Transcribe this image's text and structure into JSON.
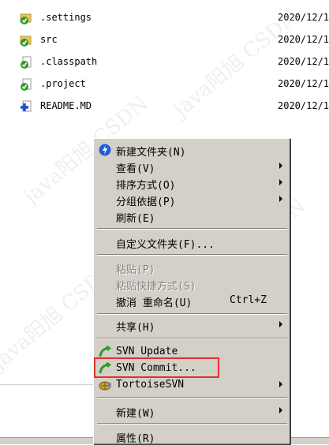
{
  "files": [
    {
      "name": ".settings",
      "date": "2020/12/1",
      "icon": "folder-svn-ok-icon"
    },
    {
      "name": "src",
      "date": "2020/12/1",
      "icon": "folder-svn-ok-icon"
    },
    {
      "name": ".classpath",
      "date": "2020/12/1",
      "icon": "file-svn-ok-icon"
    },
    {
      "name": ".project",
      "date": "2020/12/1",
      "icon": "file-svn-ok-icon"
    },
    {
      "name": "README.MD",
      "date": "2020/12/1",
      "icon": "file-svn-added-icon"
    }
  ],
  "menu": {
    "new_folder": "新建文件夹(N)",
    "view": "查看(V)",
    "sort_by": "排序方式(O)",
    "group_by": "分组依据(P)",
    "refresh": "刷新(E)",
    "customize_folder": "自定义文件夹(F)...",
    "paste": "粘贴(P)",
    "paste_shortcut": "粘贴快捷方式(S)",
    "undo_rename": "撤消 重命名(U)",
    "undo_shortcut": "Ctrl+Z",
    "share": "共享(H)",
    "svn_update": "SVN Update",
    "svn_commit": "SVN Commit...",
    "tortoise_svn": "TortoiseSVN",
    "new": "新建(W)",
    "properties": "属性(R)"
  },
  "watermark": "java阳旭 CSDN",
  "colors": {
    "menu_bg": "#d4d0c8",
    "svn_green": "#2e9a2e",
    "highlight_red": "#e03030",
    "added_blue": "#1a4fd6"
  }
}
